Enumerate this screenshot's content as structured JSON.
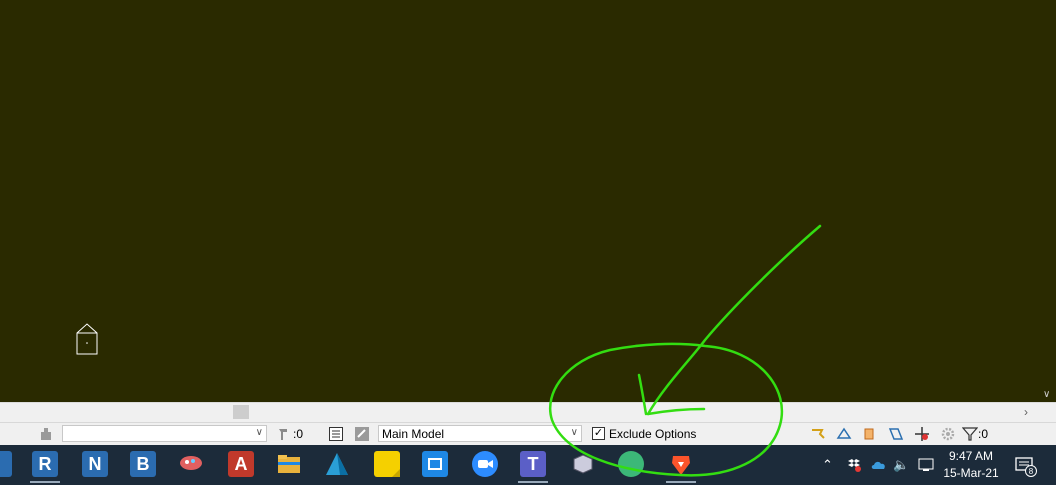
{
  "statusbar": {
    "selection_filter_count": ":0",
    "workset_value": "Main Model",
    "exclude_options_label": "Exclude Options",
    "exclude_options_checked": true,
    "filter_count": ":0"
  },
  "taskbar": {
    "apps": [
      {
        "name": "revit-r-app",
        "glyph": "R",
        "color": "#2b6cb0"
      },
      {
        "name": "navisworks-app",
        "glyph": "N",
        "color": "#2b6cb0"
      },
      {
        "name": "bim-b-app",
        "glyph": "B",
        "color": "#2b6cb0"
      },
      {
        "name": "paint-app",
        "glyph": "",
        "color": "#d9534f"
      },
      {
        "name": "autocad-app",
        "glyph": "A",
        "color": "#c0392b"
      },
      {
        "name": "file-explorer-app",
        "glyph": "",
        "color": "#e8b23c"
      },
      {
        "name": "autodesk-app",
        "glyph": "",
        "color": "#2a9fd6"
      },
      {
        "name": "sticky-notes-app",
        "glyph": "",
        "color": "#f5d000"
      },
      {
        "name": "store-app",
        "glyph": "",
        "color": "#1e88e5"
      },
      {
        "name": "zoom-app",
        "glyph": "",
        "color": "#2d8cff"
      },
      {
        "name": "teams-app",
        "glyph": "T",
        "color": "#5b5fc7"
      },
      {
        "name": "viewer-3d-app",
        "glyph": "",
        "color": "#8aa"
      },
      {
        "name": "chat-app",
        "glyph": "",
        "color": "#3cb878"
      },
      {
        "name": "brave-app",
        "glyph": "",
        "color": "#fb542b"
      }
    ],
    "time": "9:47 AM",
    "date": "15-Mar-21",
    "notification_count": "8"
  },
  "colors": {
    "canvas": "#2a2a00",
    "annotation": "#33dd11"
  }
}
